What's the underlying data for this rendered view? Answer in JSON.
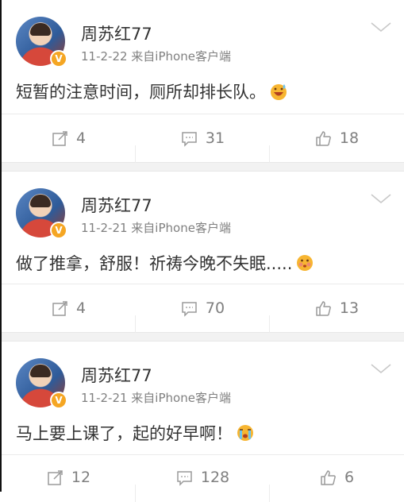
{
  "posts": [
    {
      "author": "周苏红77",
      "meta": "11-2-22 来自iPhone客户端",
      "text": "短暂的注意时间，厕所却排长队。",
      "emoji": "grinning-sweat-emoji",
      "repost_count": "4",
      "comment_count": "31",
      "like_count": "18"
    },
    {
      "author": "周苏红77",
      "meta": "11-2-21 来自iPhone客户端",
      "text": "做了推拿，舒服！祈祷今晚不失眠.....",
      "emoji": "blushing-emoji",
      "repost_count": "4",
      "comment_count": "70",
      "like_count": "13"
    },
    {
      "author": "周苏红77",
      "meta": "11-2-21 来自iPhone客户端",
      "text": "马上要上课了，起的好早啊！",
      "emoji": "crying-emoji",
      "repost_count": "12",
      "comment_count": "128",
      "like_count": "6"
    }
  ],
  "badge": "V",
  "colors": {
    "badge": "#f5a623",
    "text": "#333333",
    "meta": "#808080",
    "action": "#7f7f7f",
    "gap": "#f2f2f2"
  }
}
